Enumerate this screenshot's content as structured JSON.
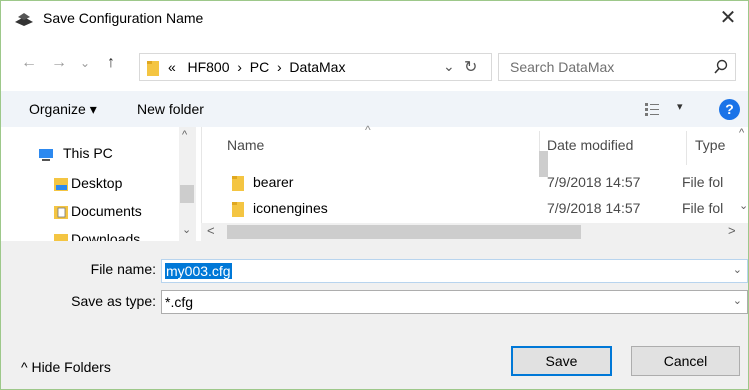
{
  "window": {
    "title": "Save Configuration Name",
    "close_glyph": "✕"
  },
  "nav": {
    "back_glyph": "←",
    "forward_glyph": "→",
    "recent_glyph": "⌄",
    "up_glyph": "↑",
    "address": {
      "overflow": "«",
      "crumbs": [
        "HF800",
        "PC",
        "DataMax"
      ],
      "separator": "›"
    },
    "address_dropdown_glyph": "⌄",
    "refresh_glyph": "↻",
    "search_placeholder": "Search DataMax"
  },
  "toolbar": {
    "organize_label": "Organize ▾",
    "new_folder_label": "New folder",
    "view_caret": "▾",
    "help_label": "?"
  },
  "tree": {
    "items": [
      {
        "label": "This PC",
        "icon": "computer-icon"
      },
      {
        "label": "Desktop",
        "icon": "desktop-folder-icon"
      },
      {
        "label": "Documents",
        "icon": "documents-folder-icon"
      },
      {
        "label": "Downloads",
        "icon": "downloads-folder-icon"
      }
    ],
    "scroll_up": "^",
    "scroll_down": "⌄"
  },
  "file_list": {
    "columns": [
      "Name",
      "Date modified",
      "Type"
    ],
    "sort_caret": "^",
    "rows": [
      {
        "name": "bearer",
        "date": "7/9/2018 14:57",
        "type": "File fol"
      },
      {
        "name": "iconengines",
        "date": "7/9/2018 14:57",
        "type": "File fol"
      }
    ],
    "hscroll_left": "<",
    "hscroll_right": ">",
    "vscroll_up": "^",
    "vscroll_down": "⌄"
  },
  "form": {
    "file_name_label": "File name:",
    "file_name_value": "my003.cfg",
    "save_as_type_label": "Save as type:",
    "save_as_type_value": "*.cfg",
    "combo_caret": "⌄"
  },
  "footer": {
    "hide_folders_label": "^ Hide Folders",
    "save_label": "Save",
    "cancel_label": "Cancel"
  },
  "colors": {
    "accent": "#0078d7",
    "folder": "#f4c542",
    "toolbar_bg": "#f0f4f9",
    "help": "#1a73e8"
  }
}
